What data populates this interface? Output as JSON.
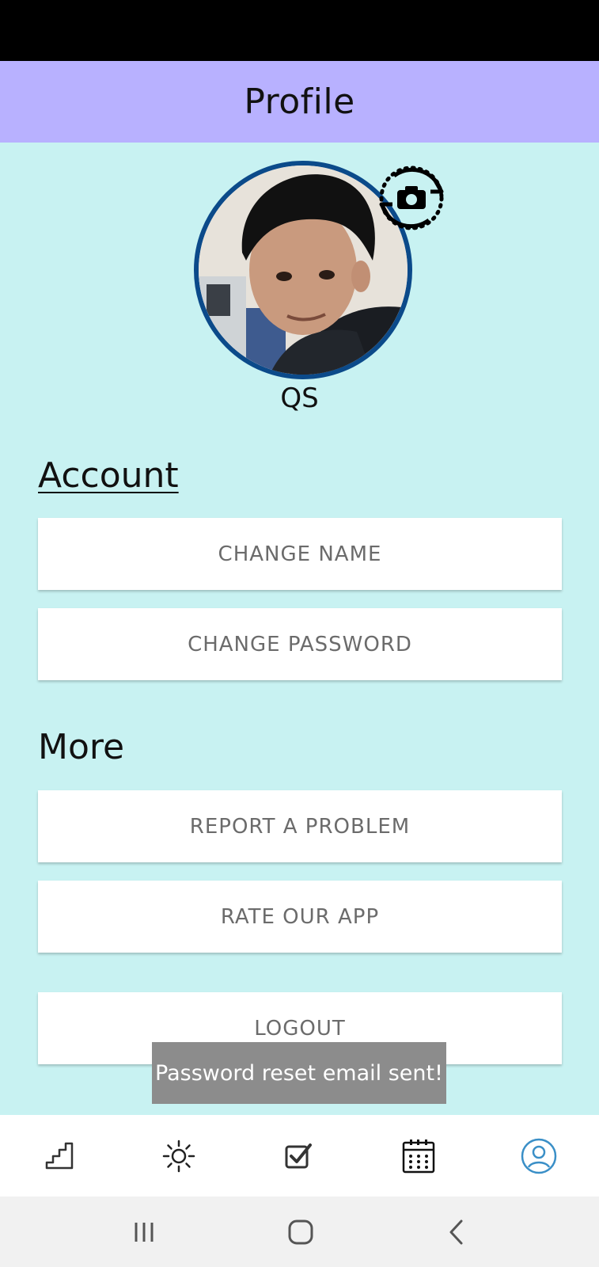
{
  "header": {
    "title": "Profile"
  },
  "profile": {
    "name": "QS",
    "avatar_alt": "profile-photo",
    "camera_icon": "camera-rotate-icon"
  },
  "account": {
    "title": "Account",
    "buttons": {
      "change_name": "CHANGE NAME",
      "change_password": "CHANGE PASSWORD"
    }
  },
  "more": {
    "title": "More",
    "buttons": {
      "report": "REPORT A PROBLEM",
      "rate": "RATE OUR APP",
      "logout": "LOGOUT"
    }
  },
  "toast": {
    "message": "Password reset email sent!"
  },
  "bottom_nav": {
    "items": [
      {
        "icon": "stairs-icon"
      },
      {
        "icon": "sun-icon"
      },
      {
        "icon": "checkbox-icon"
      },
      {
        "icon": "calendar-icon"
      },
      {
        "icon": "profile-icon",
        "active": true
      }
    ],
    "active_color": "#3a8fc7"
  },
  "colors": {
    "header_bg": "#b8b1ff",
    "content_bg": "#c8f2f2",
    "avatar_border": "#0b4a8a",
    "toast_bg": "#8c8c8c"
  }
}
